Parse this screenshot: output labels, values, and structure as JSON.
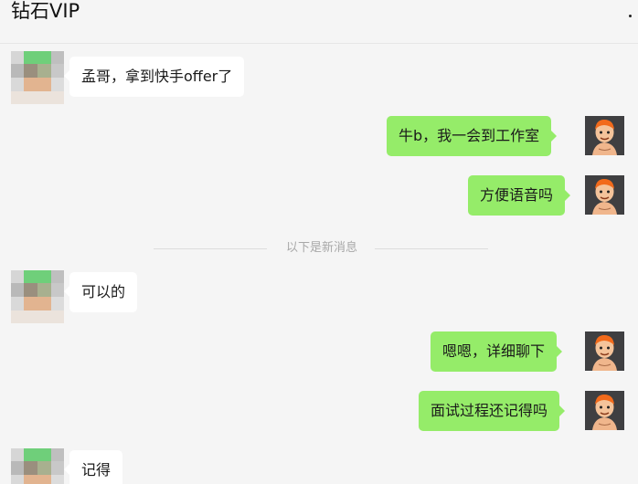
{
  "chat": {
    "title": "钻石VIP",
    "divider": "以下是新消息",
    "messages": [
      {
        "from": "other",
        "text": "孟哥，拿到快手offer了"
      },
      {
        "from": "me",
        "text": "牛b，我一会到工作室"
      },
      {
        "from": "me",
        "text": "方便语音吗"
      },
      {
        "from": "other",
        "text": "可以的"
      },
      {
        "from": "me",
        "text": "嗯嗯，详细聊下"
      },
      {
        "from": "me",
        "text": "面试过程还记得吗"
      },
      {
        "from": "other",
        "text": "记得"
      }
    ]
  },
  "colors": {
    "background": "#f5f5f5",
    "incoming_bubble": "#ffffff",
    "outgoing_bubble": "#95ec69",
    "divider_text": "#a8a8a8"
  },
  "icons": {
    "more": "more-dots-icon",
    "contact_avatar": "pixelated-avatar",
    "my_avatar": "cartoon-character-avatar"
  }
}
